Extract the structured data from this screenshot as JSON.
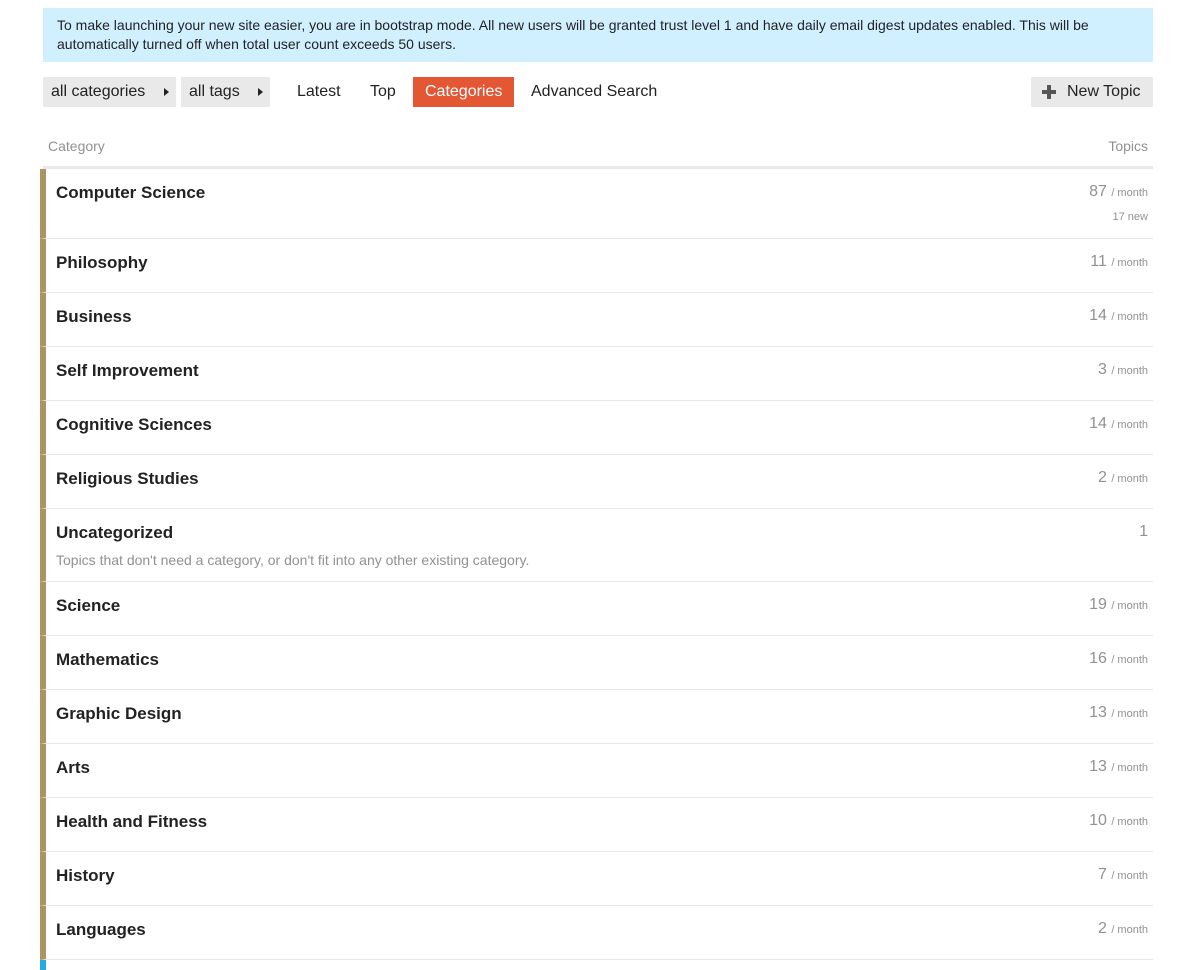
{
  "banner": {
    "text": "To make launching your new site easier, you are in bootstrap mode. All new users will be granted trust level 1 and have daily email digest updates enabled. This will be automatically turned off when total user count exceeds 50 users."
  },
  "nav": {
    "categories_dropdown": "all categories",
    "tags_dropdown": "all tags",
    "tabs": [
      {
        "label": "Latest"
      },
      {
        "label": "Top"
      },
      {
        "label": "Categories"
      },
      {
        "label": "Advanced Search"
      }
    ],
    "active_tab": "Categories",
    "new_topic": "New Topic",
    "accent_color": "#e45735"
  },
  "table": {
    "col_category": "Category",
    "col_topics": "Topics",
    "unit": "/ month",
    "category_color": "#ab9364",
    "rows": [
      {
        "name": "Computer Science",
        "count": "87",
        "unit": "/ month",
        "new": "17 new"
      },
      {
        "name": "Philosophy",
        "count": "11",
        "unit": "/ month"
      },
      {
        "name": "Business",
        "count": "14",
        "unit": "/ month"
      },
      {
        "name": "Self Improvement",
        "count": "3",
        "unit": "/ month"
      },
      {
        "name": "Cognitive Sciences",
        "count": "14",
        "unit": "/ month"
      },
      {
        "name": "Religious Studies",
        "count": "2",
        "unit": "/ month"
      },
      {
        "name": "Uncategorized",
        "count": "1",
        "description": "Topics that don't need a category, or don't fit into any other existing category."
      },
      {
        "name": "Science",
        "count": "19",
        "unit": "/ month"
      },
      {
        "name": "Mathematics",
        "count": "16",
        "unit": "/ month"
      },
      {
        "name": "Graphic Design",
        "count": "13",
        "unit": "/ month"
      },
      {
        "name": "Arts",
        "count": "13",
        "unit": "/ month"
      },
      {
        "name": "Health and Fitness",
        "count": "10",
        "unit": "/ month"
      },
      {
        "name": "History",
        "count": "7",
        "unit": "/ month"
      },
      {
        "name": "Languages",
        "count": "2",
        "unit": "/ month"
      }
    ]
  }
}
